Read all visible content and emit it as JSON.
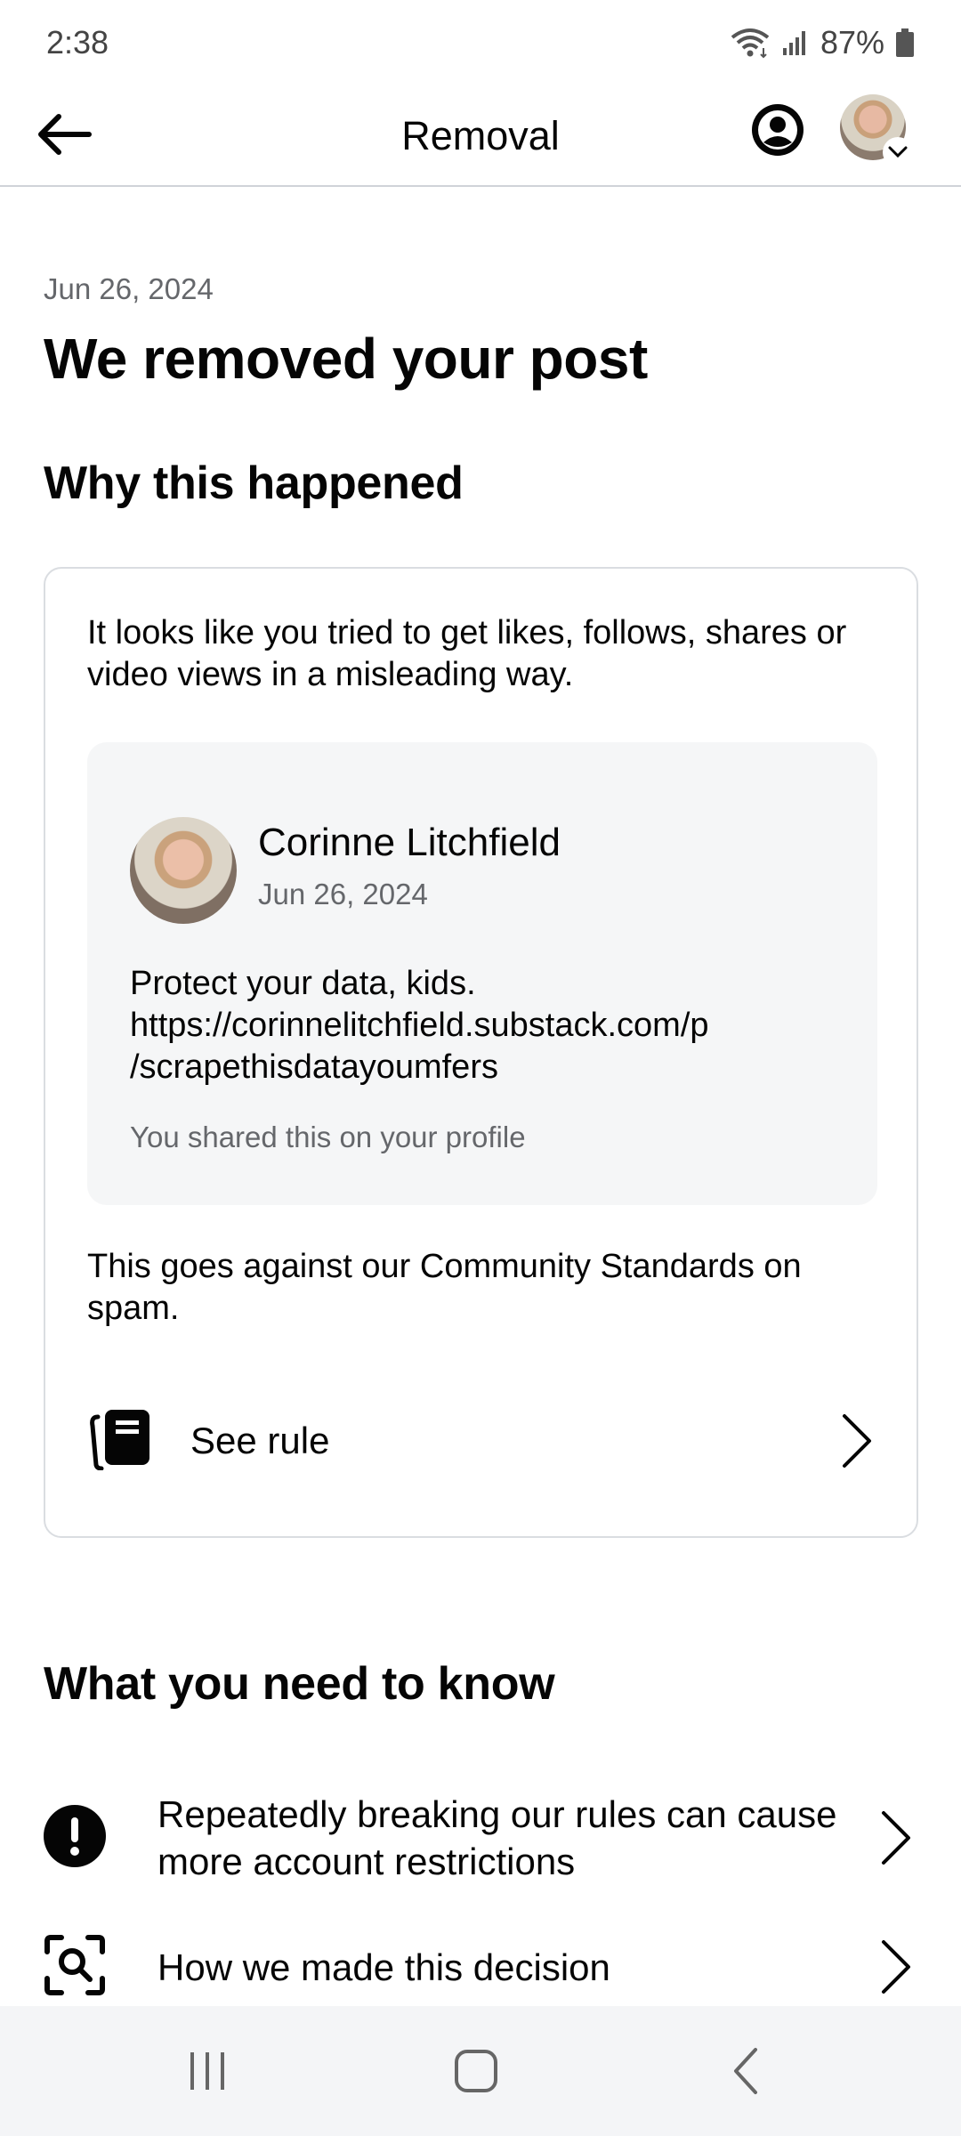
{
  "status_bar": {
    "time": "2:38",
    "battery": "87%"
  },
  "app_bar": {
    "title": "Removal",
    "icons": [
      "back-arrow-icon",
      "profile-circle-icon",
      "avatar-menu-chevron-icon"
    ]
  },
  "header": {
    "date": "Jun 26, 2024",
    "title": "We removed your post"
  },
  "why": {
    "heading": "Why this happened",
    "reason": "It looks like you tried to get likes, follows, shares or video views in a misleading way.",
    "post": {
      "author": "Corinne Litchfield",
      "date": "Jun 26, 2024",
      "body_lines": [
        "Protect your data, kids.",
        "https://corinnelitchfield.substack.com/p",
        "/scrapethisdatayoumfers"
      ],
      "shared_note": "You shared this on your profile"
    },
    "standards": "This goes against our Community Standards on spam.",
    "see_rule_label": "See rule"
  },
  "know": {
    "heading": "What you need to know",
    "items": [
      {
        "label": "Repeatedly breaking our rules can cause more account restrictions",
        "icon": "exclamation-circle-icon"
      },
      {
        "label": "How we made this decision",
        "icon": "magnify-scan-icon"
      }
    ]
  },
  "nav": {
    "icons": [
      "recents-icon",
      "home-icon",
      "back-icon"
    ]
  }
}
